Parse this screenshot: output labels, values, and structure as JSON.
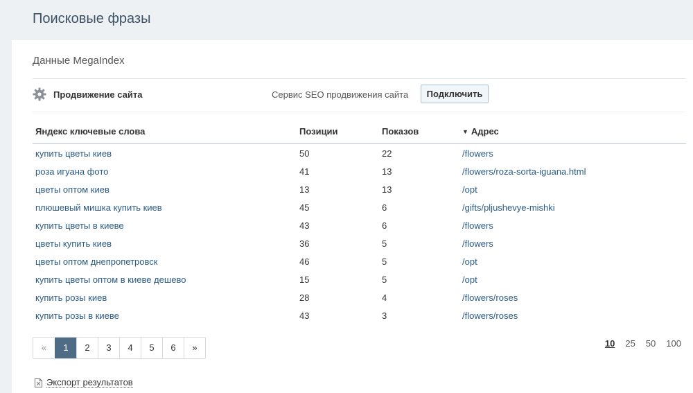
{
  "page": {
    "title": "Поисковые фразы"
  },
  "section": {
    "title": "Данные MegaIndex"
  },
  "promo": {
    "label": "Продвижение сайта",
    "description": "Сервис SEO продвижения сайта",
    "button_label": "Подключить",
    "icon": "gear-icon"
  },
  "table": {
    "headers": {
      "keywords": "Яндекс ключевые слова",
      "positions": "Позиции",
      "shows": "Показов",
      "address": "Адрес"
    },
    "sort_indicator": "▼",
    "rows": [
      {
        "keyword": "купить цветы киев",
        "position": "50",
        "shows": "22",
        "url": "/flowers"
      },
      {
        "keyword": "роза игуана фото",
        "position": "41",
        "shows": "13",
        "url": "/flowers/roza-sorta-iguana.html"
      },
      {
        "keyword": "цветы оптом киев",
        "position": "13",
        "shows": "13",
        "url": "/opt"
      },
      {
        "keyword": "плюшевый мишка купить киев",
        "position": "45",
        "shows": "6",
        "url": "/gifts/pljushevye-mishki"
      },
      {
        "keyword": "купить цветы в киеве",
        "position": "43",
        "shows": "6",
        "url": "/flowers"
      },
      {
        "keyword": "цветы купить киев",
        "position": "36",
        "shows": "5",
        "url": "/flowers"
      },
      {
        "keyword": "цветы оптом днепропетровск",
        "position": "46",
        "shows": "5",
        "url": "/opt"
      },
      {
        "keyword": "купить цветы оптом в киеве дешево",
        "position": "15",
        "shows": "5",
        "url": "/opt"
      },
      {
        "keyword": "купить розы киев",
        "position": "28",
        "shows": "4",
        "url": "/flowers/roses"
      },
      {
        "keyword": "купить розы в киеве",
        "position": "43",
        "shows": "3",
        "url": "/flowers/roses"
      }
    ]
  },
  "pagination": {
    "prev": "«",
    "pages": [
      "1",
      "2",
      "3",
      "4",
      "5",
      "6"
    ],
    "active_page": "1",
    "next": "»"
  },
  "per_page": {
    "options": [
      "10",
      "25",
      "50",
      "100"
    ],
    "selected": "10"
  },
  "export": {
    "label": "Экспорт результатов",
    "icon": "document-icon"
  }
}
